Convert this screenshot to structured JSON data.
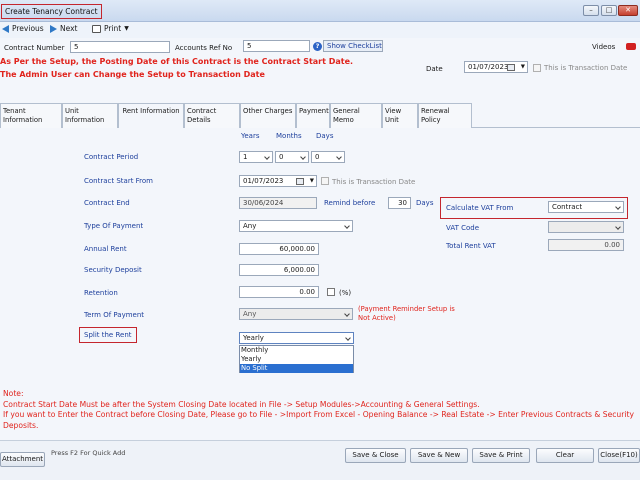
{
  "window": {
    "title": "Create Tenancy Contract",
    "min_icon": "minimize-icon",
    "max_icon": "maximize-icon",
    "close_icon": "close-icon"
  },
  "toolbar": {
    "previous_label": "Previous",
    "next_label": "Next",
    "print_label": "Print"
  },
  "header": {
    "contract_number_label": "Contract Number",
    "contract_number_value": "5",
    "accounts_ref_label": "Accounts Ref No",
    "accounts_ref_value": "5",
    "show_checklist_label": "Show CheckList",
    "videos_label": "Videos",
    "date_label": "Date",
    "date_value": "01/07/2023",
    "transaction_date_label": "This is Transaction Date"
  },
  "warnings": {
    "line1": "As Per the Setup, the Posting Date of this Contract is the Contract Start Date.",
    "line2": "The Admin User can Change the Setup to Transaction Date"
  },
  "tabs": [
    {
      "label": "Tenant Information"
    },
    {
      "label": "Unit Information"
    },
    {
      "label": "Rent Information"
    },
    {
      "label": "Contract Details"
    },
    {
      "label": "Other Charges"
    },
    {
      "label": "Payment"
    },
    {
      "label": "General Memo"
    },
    {
      "label": "View Unit"
    },
    {
      "label": "Renewal Policy"
    }
  ],
  "rent": {
    "col_years": "Years",
    "col_months": "Months",
    "col_days": "Days",
    "contract_period_label": "Contract Period",
    "period_years": "1",
    "period_months": "0",
    "period_days": "0",
    "contract_start_label": "Contract Start From",
    "contract_start_value": "01/07/2023",
    "start_transaction_label": "This is Transaction Date",
    "contract_end_label": "Contract End",
    "contract_end_value": "30/06/2024",
    "remind_before_label": "Remind before",
    "remind_before_value": "30",
    "remind_unit": "Days",
    "type_of_payment_label": "Type Of Payment",
    "type_of_payment_value": "Any",
    "annual_rent_label": "Annual Rent",
    "annual_rent_value": "60,000.00",
    "security_deposit_label": "Security Deposit",
    "security_deposit_value": "6,000.00",
    "retention_label": "Retention",
    "retention_value": "0.00",
    "retention_pct": "(%)",
    "term_of_payment_label": "Term Of Payment",
    "term_of_payment_value": "Any",
    "payment_reminder_note": "(Payment Reminder Setup is Not Active)",
    "split_rent_label": "Split the Rent",
    "split_rent_value": "Yearly",
    "split_options": [
      "Monthly",
      "Yearly",
      "No Split"
    ],
    "split_selected_index": 2
  },
  "vat": {
    "calc_from_label": "Calculate VAT From",
    "calc_from_value": "Contract",
    "vat_code_label": "VAT Code",
    "total_rent_vat_label": "Total Rent VAT",
    "total_rent_vat_value": "0.00"
  },
  "note": {
    "title": "Note:",
    "line1": "Contract Start Date Must be after the System Closing Date located in File -> Setup Modules->Accounting & General Settings.",
    "line2": "If you want to Enter the Contract before Closing Date, Please go to File - >Import From Excel - Opening Balance -> Real Estate -> Enter Previous Contracts & Security",
    "line3": "Deposits."
  },
  "bottom": {
    "attachment_label": "Attachment",
    "quick_add_hint": "Press F2 For Quick Add",
    "save_close": "Save & Close",
    "save_new": "Save & New",
    "save_print": "Save & Print",
    "clear": "Clear",
    "close": "Close(F10)"
  },
  "colors": {
    "warning_red": "#e0241d",
    "label_blue": "#1d3f9c",
    "highlight_box": "#c4262e",
    "selected_option": "#2a6fd0"
  }
}
